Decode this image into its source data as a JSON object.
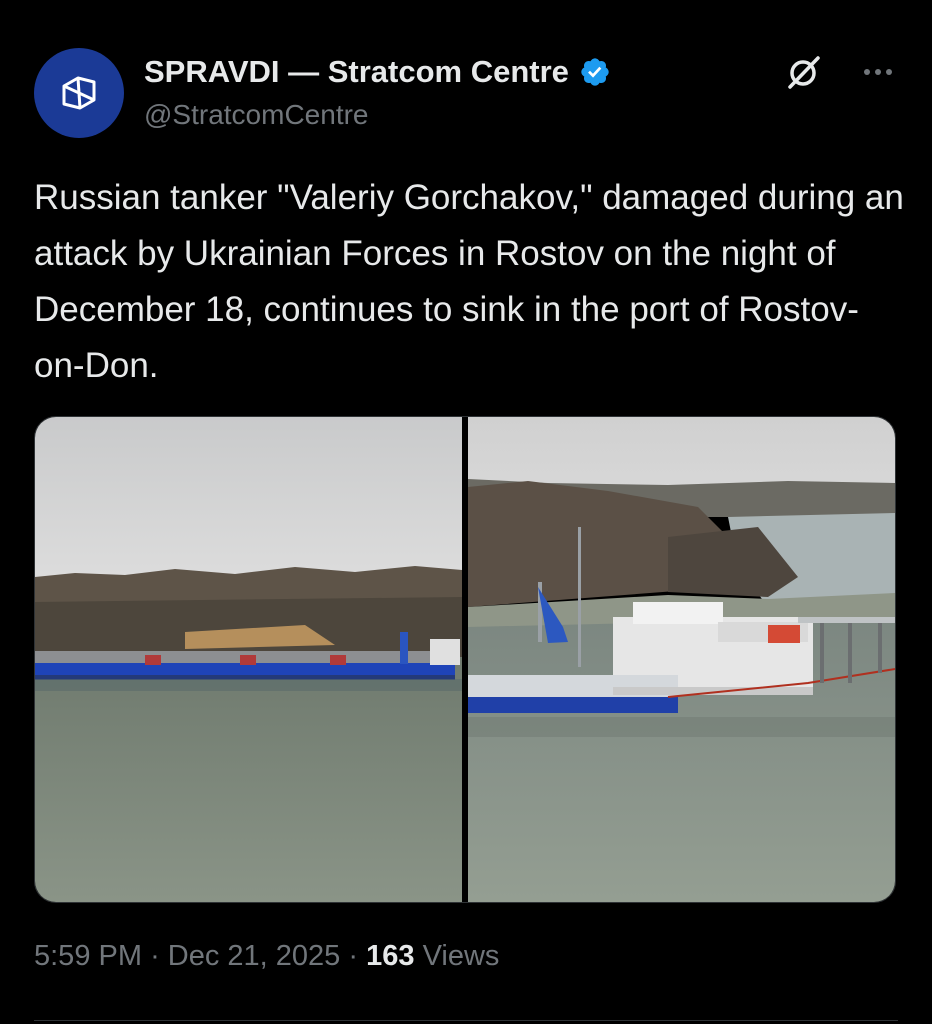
{
  "author": {
    "name": "SPRAVDI — Stratcom Centre",
    "handle": "@StratcomCentre",
    "verified": true,
    "verified_color": "#1d9bf0",
    "avatar_color": "#1b3a96"
  },
  "tweet": {
    "text": "Russian tanker \"Valeriy Gorchakov,\" damaged during an attack by Ukrainian Forces in Rostov on the night of December 18, continues to sink in the port of Rostov-on-Don."
  },
  "media": {
    "count": 2,
    "photos": [
      {
        "subject": "river-barge-photo"
      },
      {
        "subject": "sinking-tanker-photo"
      }
    ]
  },
  "meta": {
    "time": "5:59 PM",
    "separator": "·",
    "date": "Dec 21, 2025",
    "views_count": "163",
    "views_label": "Views"
  },
  "icons": {
    "grok": "grok-icon",
    "more": "more-icon",
    "verified": "verified-badge-icon"
  }
}
